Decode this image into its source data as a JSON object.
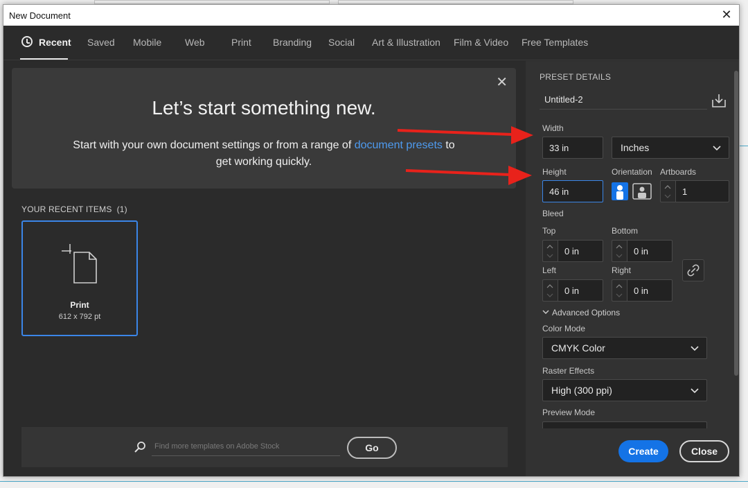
{
  "window": {
    "title": "New Document"
  },
  "tabs": [
    {
      "label": "Recent"
    },
    {
      "label": "Saved"
    },
    {
      "label": "Mobile"
    },
    {
      "label": "Web"
    },
    {
      "label": "Print"
    },
    {
      "label": "Branding"
    },
    {
      "label": "Social"
    },
    {
      "label": "Art & Illustration"
    },
    {
      "label": "Film & Video"
    },
    {
      "label": "Free Templates"
    }
  ],
  "hero": {
    "title": "Let’s start something new.",
    "subtitle_prefix": "Start with your own document settings or from a range of ",
    "subtitle_link": "document presets",
    "subtitle_suffix": " to get working quickly."
  },
  "recent": {
    "heading": "YOUR RECENT ITEMS",
    "count": "(1)",
    "items": [
      {
        "name": "Print",
        "size": "612 x 792 pt"
      }
    ]
  },
  "search": {
    "placeholder": "Find more templates on Adobe Stock",
    "go_label": "Go"
  },
  "preset": {
    "heading": "PRESET DETAILS",
    "name": "Untitled-2",
    "width_label": "Width",
    "width_value": "33 in",
    "units": "Inches",
    "height_label": "Height",
    "height_value": "46 in",
    "orientation_label": "Orientation",
    "artboards_label": "Artboards",
    "artboards_value": "1",
    "bleed_label": "Bleed",
    "bleed": {
      "top_label": "Top",
      "top_value": "0 in",
      "bottom_label": "Bottom",
      "bottom_value": "0 in",
      "left_label": "Left",
      "left_value": "0 in",
      "right_label": "Right",
      "right_value": "0 in"
    },
    "advanced_label": "Advanced Options",
    "color_mode_label": "Color Mode",
    "color_mode_value": "CMYK Color",
    "raster_label": "Raster Effects",
    "raster_value": "High (300 ppi)",
    "preview_label": "Preview Mode"
  },
  "buttons": {
    "create": "Create",
    "close": "Close"
  },
  "colors": {
    "accent": "#1473e6",
    "link": "#4e9bf0",
    "annotation_arrow": "#e8221b"
  }
}
